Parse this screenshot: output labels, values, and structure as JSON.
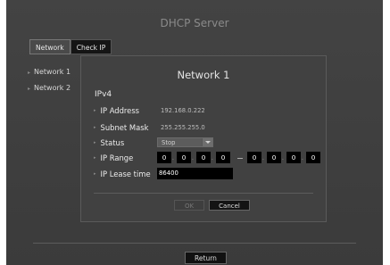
{
  "app": {
    "title": "DHCP Server"
  },
  "tabs": [
    {
      "label": "Network",
      "active": true
    },
    {
      "label": "Check IP",
      "active": false
    }
  ],
  "sidebar": {
    "items": [
      {
        "label": "Network 1"
      },
      {
        "label": "Network 2"
      }
    ]
  },
  "footer": {
    "return_label": "Return"
  },
  "dialog": {
    "title": "Network 1",
    "section": "IPv4",
    "ip_address": {
      "label": "IP Address",
      "value": "192.168.0.222"
    },
    "subnet_mask": {
      "label": "Subnet Mask",
      "value": "255.255.255.0"
    },
    "status": {
      "label": "Status",
      "value": "Stop"
    },
    "ip_range": {
      "label": "IP Range",
      "start": [
        "0",
        "0",
        "0",
        "0"
      ],
      "end": [
        "0",
        "0",
        "0",
        "0"
      ]
    },
    "lease_time": {
      "label": "IP Lease time",
      "value": "86400"
    },
    "ok_label": "OK",
    "cancel_label": "Cancel"
  }
}
